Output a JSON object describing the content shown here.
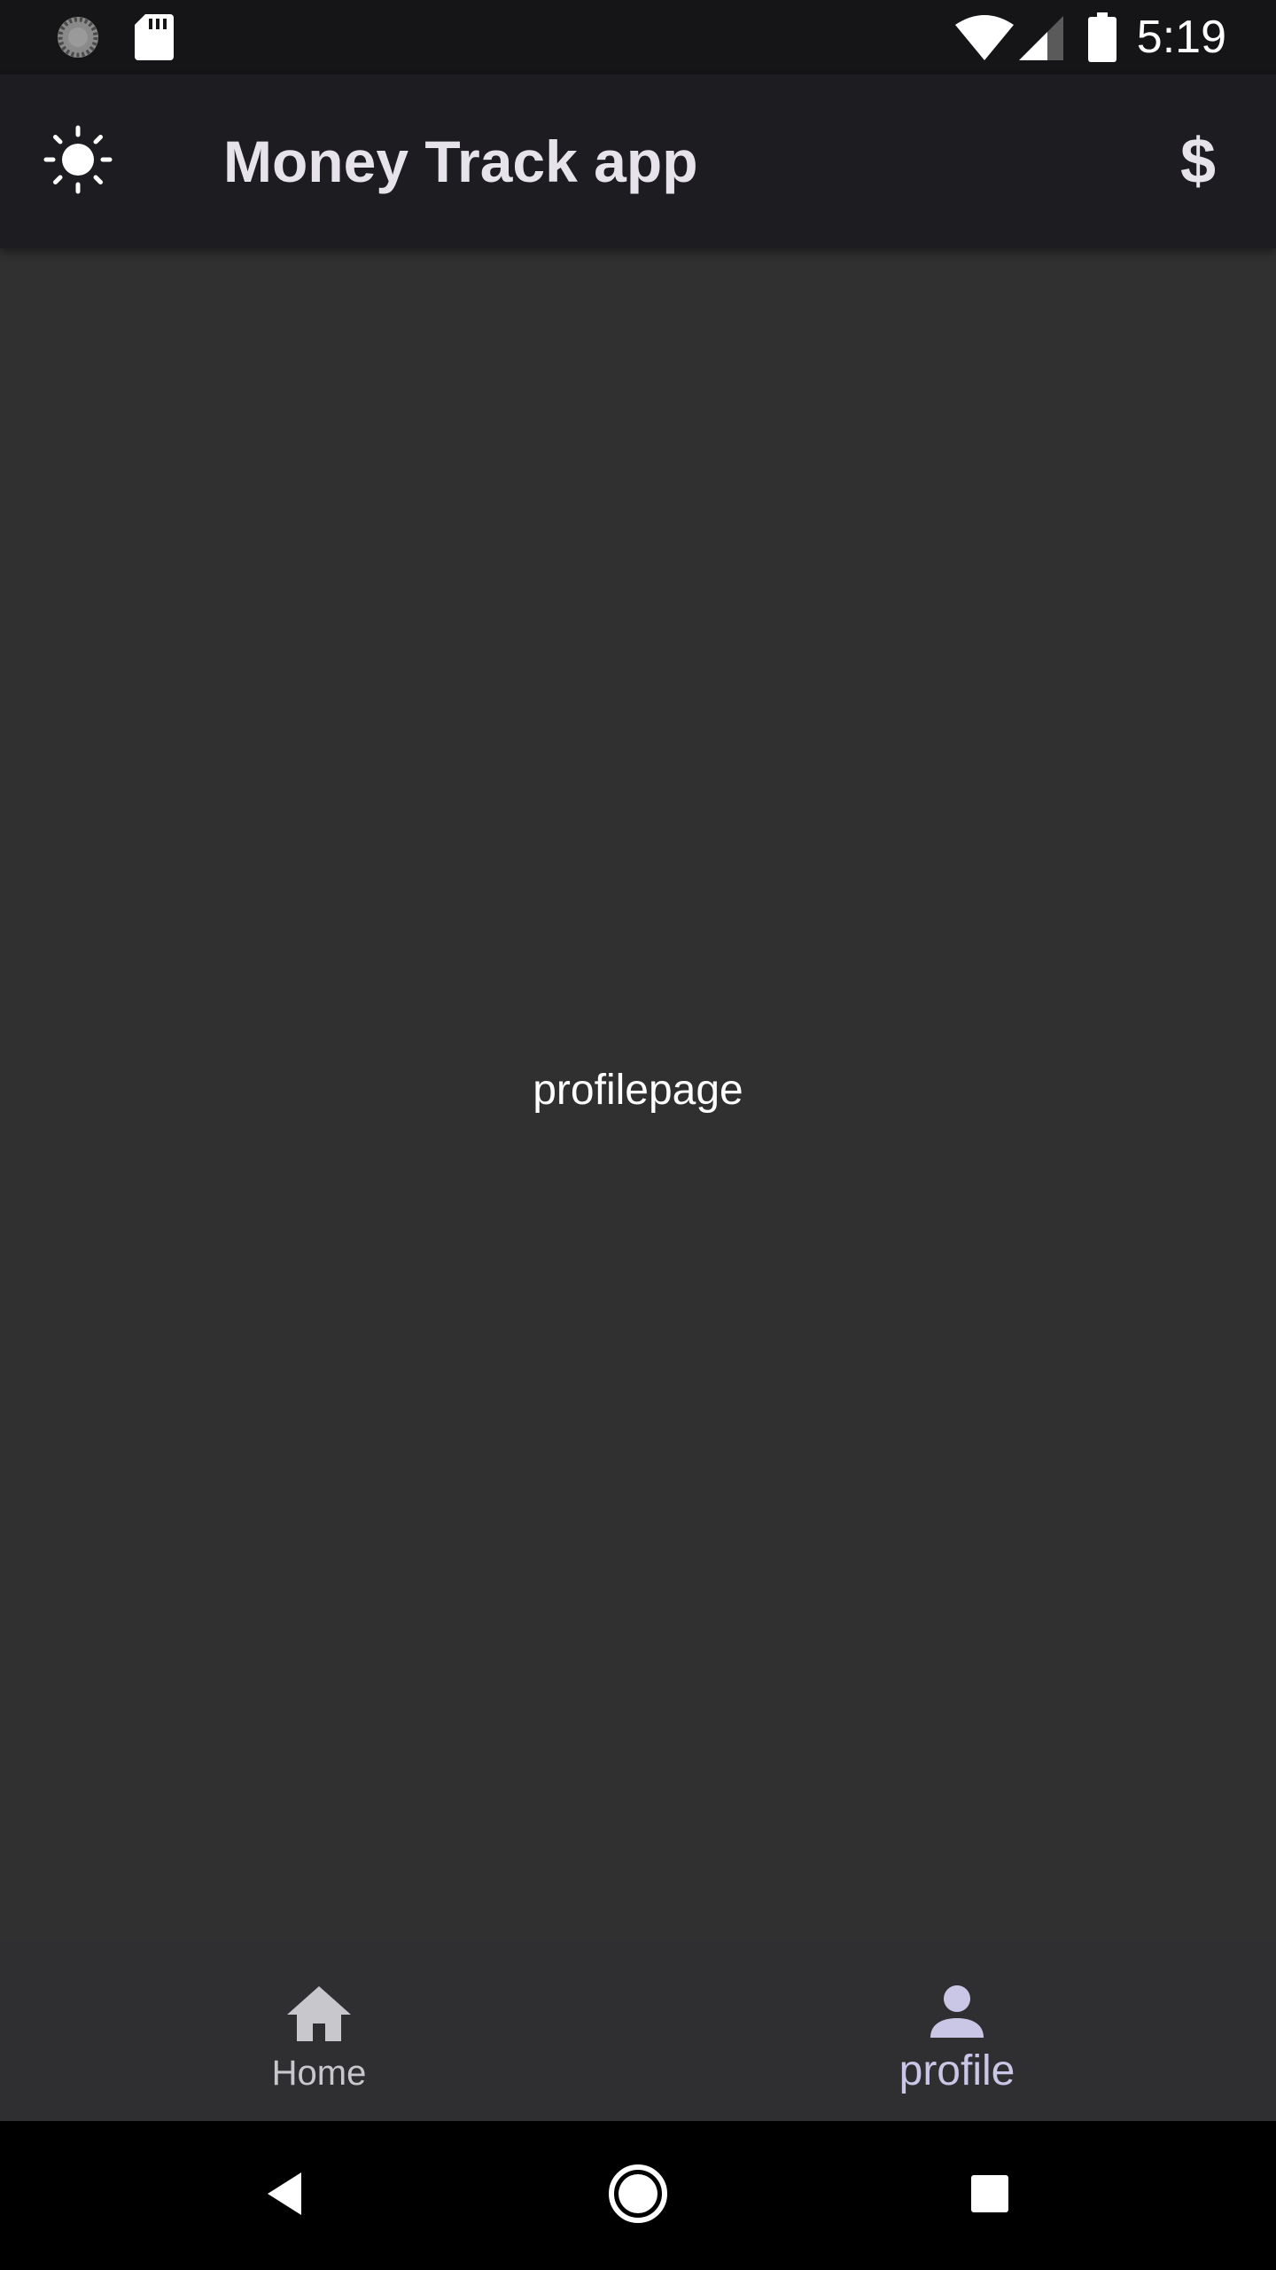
{
  "status_bar": {
    "time": "5:19",
    "icons": [
      "sync-icon",
      "sd-card-icon",
      "wifi-icon",
      "cell-signal-icon",
      "battery-icon"
    ]
  },
  "app_bar": {
    "title": "Money Track app",
    "leading_icon": "sun-icon",
    "trailing_label": "$"
  },
  "content": {
    "page_label": "profilepage"
  },
  "bottom_nav": {
    "items": [
      {
        "label": "Home",
        "icon": "home-icon",
        "selected": false
      },
      {
        "label": "profile",
        "icon": "person-icon",
        "selected": true
      }
    ]
  },
  "system_nav": {
    "icons": [
      "back-icon",
      "home-circle-icon",
      "recents-icon"
    ]
  },
  "colors": {
    "status_bar_bg": "#151518",
    "app_bar_bg": "#1c1c21",
    "content_bg": "#303030",
    "bottom_nav_bg": "#2f2f32",
    "selected_accent": "#c9c6e6"
  }
}
